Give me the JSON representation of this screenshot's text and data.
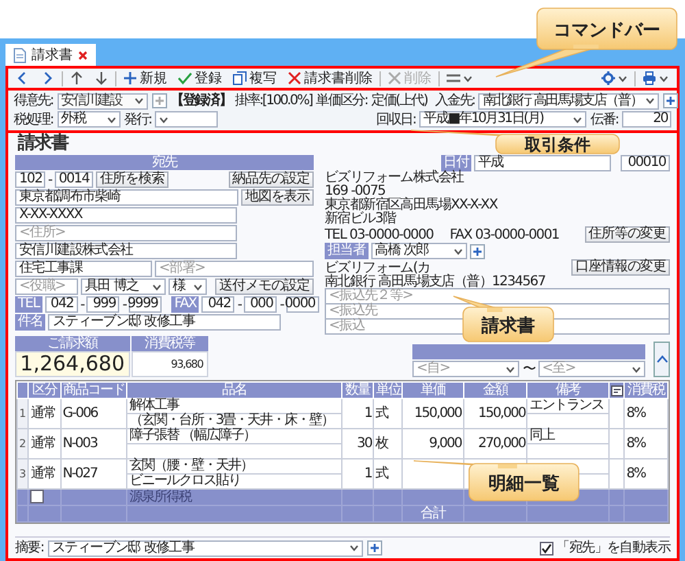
{
  "tabs": [
    {
      "label": "請求書",
      "selected": true
    }
  ],
  "command_bar": {
    "left": [
      {
        "kind": "prev",
        "disabled": false
      },
      {
        "kind": "next",
        "disabled": false
      },
      {
        "kind": "up",
        "disabled": false
      },
      {
        "kind": "down",
        "disabled": false
      },
      {
        "kind": "new",
        "label": "新規",
        "disabled": false
      },
      {
        "kind": "save",
        "label": "登録",
        "disabled": false
      },
      {
        "kind": "copy",
        "label": "複写",
        "disabled": false
      },
      {
        "kind": "delete",
        "label": "請求書削除",
        "disabled": false
      },
      {
        "kind": "delete",
        "label": "削除",
        "disabled": true
      },
      {
        "kind": "menu",
        "disabled": false
      }
    ],
    "right": [
      {
        "kind": "settings",
        "disabled": false
      },
      {
        "kind": "print",
        "disabled": false
      }
    ]
  },
  "conditions": {
    "customer": {
      "label": "得意先:",
      "value": "安信川建設"
    },
    "status": "【登録済】",
    "rate": "掛率:[100.0%]",
    "price_class": {
      "label": "単価区分:",
      "value": "定価(上代)"
    },
    "payee": {
      "label": "入金先:",
      "value": "南北銀行 高田馬場支店（普）"
    },
    "tax": {
      "label": "税処理:",
      "value": "外税"
    },
    "issue": {
      "label": "発行:"
    },
    "collection_date": {
      "label": "回収日:",
      "value": "平成■年10月31日(月)"
    },
    "slip_no": {
      "label": "伝番:",
      "value": "20"
    }
  },
  "document": {
    "title": "請求書",
    "addressee": {
      "header": "宛先",
      "postal1": "102",
      "postal_separator": "-",
      "postal2": "0014",
      "search_button": "住所を検索",
      "delivery_button": "納品先の設定",
      "address1": "東京都調布市柴崎",
      "map_button": "地図を表示",
      "address2": "X-XX-XXXX",
      "address3": {
        "placeholder": "<住所>"
      },
      "company": "安信川建設株式会社",
      "department": "住宅工事課",
      "department2": {
        "placeholder": "<部署>"
      },
      "position": {
        "placeholder": "<役職>"
      },
      "person": "具田 博之",
      "honorific": "様",
      "memo_button": "送付メモの設定",
      "tel_label": "TEL",
      "tel": [
        "042",
        "999",
        "9999"
      ],
      "tel_separators": [
        "-",
        "-"
      ],
      "fax_label": "FAX",
      "fax": [
        "042",
        "000",
        "0000"
      ],
      "fax_separators": [
        "-",
        "-"
      ],
      "subject_label": "件名",
      "subject": "スティーブン邸 改修工事"
    },
    "amounts": [
      {
        "label": "ご請求額",
        "value": "1,264,680"
      },
      {
        "label": "消費税等",
        "value": "93,680"
      }
    ],
    "issuer": {
      "date_label": "日付",
      "date_value": "平成",
      "number": "00010",
      "company": "ビズリフォーム株式会社",
      "postal": "169 -0075",
      "address": "東京都新宿区高田馬場XX-X-XX",
      "building": "新宿ビル3階",
      "tel": "TEL 03-0000-0000",
      "fax": "FAX 03-0000-0001",
      "change_button": "住所等の変更",
      "staff_label": "担当者",
      "staff": "高橋 次郎",
      "account_name": "ビズリフォーム(カ",
      "account_button": "口座情報の変更",
      "bank": "南北銀行 高田馬場支店（普）1234567",
      "transfer_notes": [
        {
          "placeholder": "<振込先２等>"
        },
        {
          "placeholder": "<振込先"
        },
        {
          "placeholder": "<振込"
        }
      ]
    },
    "period": {
      "from": {
        "placeholder": "<自>"
      },
      "separator": "〜",
      "to": {
        "placeholder": "<至>"
      }
    }
  },
  "table": {
    "columns": [
      {
        "kind": "number"
      },
      {
        "kind": "text",
        "label": "区分"
      },
      {
        "kind": "text",
        "label": "商品コード"
      },
      {
        "kind": "name",
        "label": "品名"
      },
      {
        "kind": "text",
        "label": "数量"
      },
      {
        "kind": "text",
        "label": "単位"
      },
      {
        "kind": "text",
        "label": "単価"
      },
      {
        "kind": "text",
        "label": "金額"
      },
      {
        "kind": "note",
        "label": "備考"
      },
      {
        "kind": "icon"
      },
      {
        "kind": "text",
        "label": "消費税"
      }
    ],
    "rows": [
      {
        "no": "1",
        "class": "通常",
        "code": "G-006",
        "name": [
          "解体工事",
          "（玄関・台所・3畳・天井・床・壁）"
        ],
        "qty": "1",
        "unit": "式",
        "price": "150,000",
        "amount": "150,000",
        "note": "エントランス",
        "tax": "8%"
      },
      {
        "no": "2",
        "class": "通常",
        "code": "N-003",
        "name": [
          "障子張替 （幅広障子）"
        ],
        "qty": "30",
        "unit": "枚",
        "price": "9,000",
        "amount": "270,000",
        "note": "同上",
        "tax": "8%"
      },
      {
        "no": "3",
        "class": "通常",
        "code": "N-027",
        "name": [
          "玄関（腰・壁・天井）",
          "ビニールクロス貼り"
        ],
        "qty": "1",
        "unit": "式",
        "tax": "8%"
      }
    ],
    "withholding": {
      "checked": false,
      "label": "源泉所得税",
      "disabled": true
    },
    "total_label": "合計"
  },
  "summary": {
    "label": "摘要:",
    "value": "スティーブン邸 改修工事"
  },
  "auto_show": {
    "label": "「宛先」を自動表示",
    "checked": true
  },
  "callouts": [
    {
      "text": "コマンドバー"
    },
    {
      "text": "取引条件"
    },
    {
      "text": "請求書"
    },
    {
      "text": "明細一覧"
    }
  ]
}
